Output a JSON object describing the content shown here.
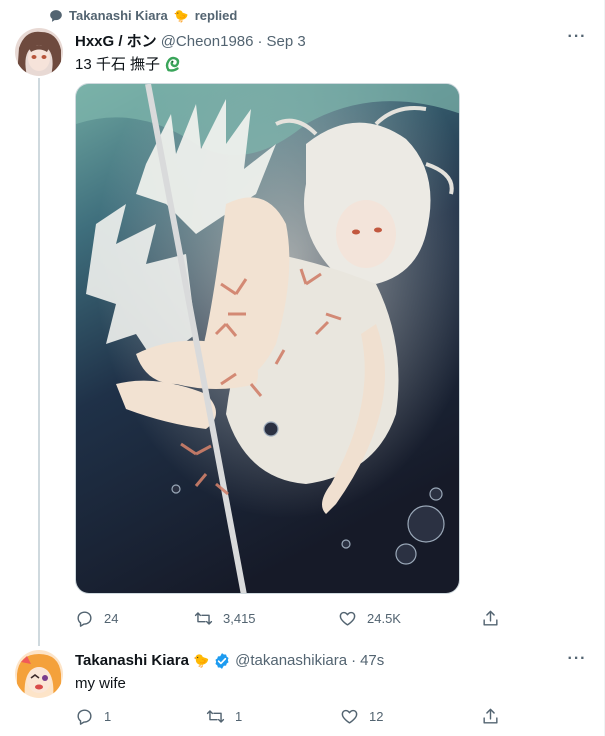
{
  "context": {
    "user": "Takanashi Kiara",
    "emoji": "🐤",
    "action": "replied"
  },
  "tweet": {
    "name": "HxxG / ホン",
    "handle": "@Cheon1986",
    "separator": "·",
    "time": "Sep 3",
    "text": "13 千石 撫子",
    "text_emoji": "snake-emoji",
    "media_description": "illustration",
    "replies": "24",
    "retweets": "3,415",
    "likes": "24.5K"
  },
  "reply": {
    "name": "Takanashi Kiara",
    "emoji": "🐤",
    "verified": true,
    "handle": "@takanashikiara",
    "separator": "·",
    "time": "47s",
    "text": "my wife",
    "replies": "1",
    "retweets": "1",
    "likes": "12"
  },
  "colors": {
    "secondary_text": "#536471",
    "verified_blue": "#1d9bf0",
    "thread_line": "#cfd9de",
    "snake_green": "#3aa55a"
  },
  "icons": [
    "speech-bubble-icon",
    "reply-icon",
    "retweet-icon",
    "like-icon",
    "share-icon",
    "more-icon",
    "verified-icon",
    "snake-emoji"
  ]
}
